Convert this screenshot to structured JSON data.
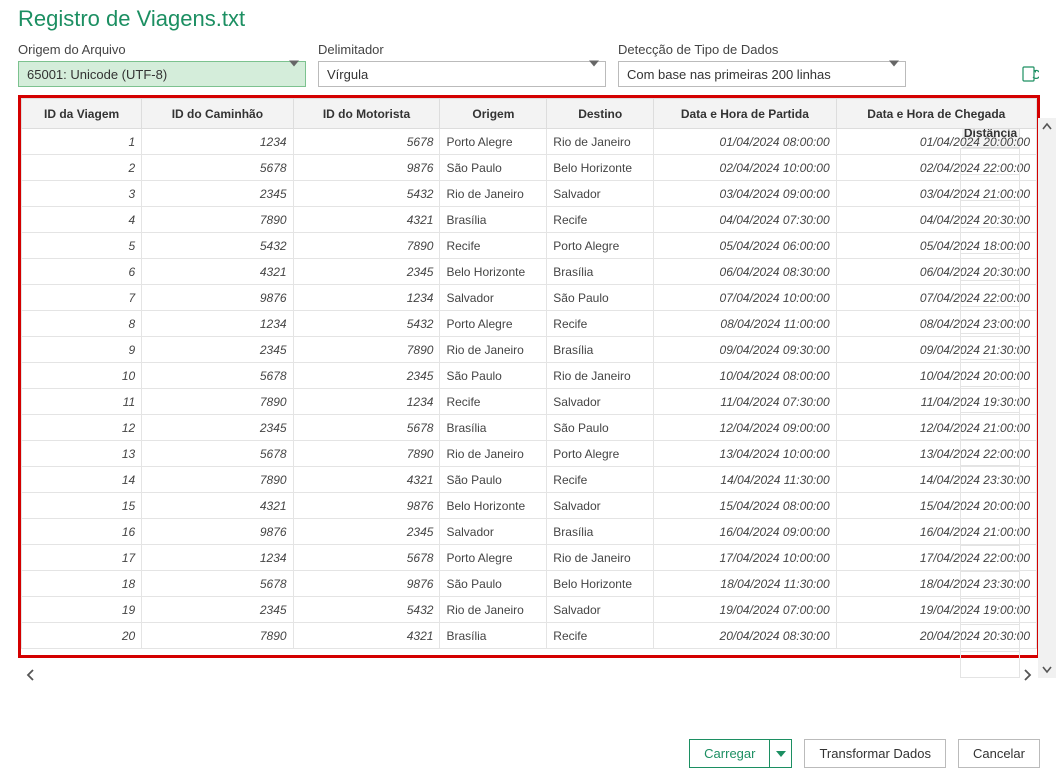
{
  "title": "Registro de Viagens.txt",
  "labels": {
    "origin": "Origem do Arquivo",
    "delimiter": "Delimitador",
    "detection": "Detecção de Tipo de Dados"
  },
  "selects": {
    "origin": "65001: Unicode (UTF-8)",
    "delimiter": "Vírgula",
    "detection": "Com base nas primeiras 200 linhas"
  },
  "columns": {
    "id": "ID da Viagem",
    "truck": "ID do Caminhão",
    "driver": "ID do Motorista",
    "origin": "Origem",
    "dest": "Destino",
    "departure": "Data e Hora de Partida",
    "arrival": "Data e Hora de Chegada",
    "distance": "Distância"
  },
  "rows": [
    {
      "id": "1",
      "truck": "1234",
      "driver": "5678",
      "origin": "Porto Alegre",
      "dest": "Rio de Janeiro",
      "dep": "01/04/2024 08:00:00",
      "arr": "01/04/2024 20:00:00"
    },
    {
      "id": "2",
      "truck": "5678",
      "driver": "9876",
      "origin": "São Paulo",
      "dest": "Belo Horizonte",
      "dep": "02/04/2024 10:00:00",
      "arr": "02/04/2024 22:00:00"
    },
    {
      "id": "3",
      "truck": "2345",
      "driver": "5432",
      "origin": "Rio de Janeiro",
      "dest": "Salvador",
      "dep": "03/04/2024 09:00:00",
      "arr": "03/04/2024 21:00:00"
    },
    {
      "id": "4",
      "truck": "7890",
      "driver": "4321",
      "origin": "Brasília",
      "dest": "Recife",
      "dep": "04/04/2024 07:30:00",
      "arr": "04/04/2024 20:30:00"
    },
    {
      "id": "5",
      "truck": "5432",
      "driver": "7890",
      "origin": "Recife",
      "dest": "Porto Alegre",
      "dep": "05/04/2024 06:00:00",
      "arr": "05/04/2024 18:00:00"
    },
    {
      "id": "6",
      "truck": "4321",
      "driver": "2345",
      "origin": "Belo Horizonte",
      "dest": "Brasília",
      "dep": "06/04/2024 08:30:00",
      "arr": "06/04/2024 20:30:00"
    },
    {
      "id": "7",
      "truck": "9876",
      "driver": "1234",
      "origin": "Salvador",
      "dest": "São Paulo",
      "dep": "07/04/2024 10:00:00",
      "arr": "07/04/2024 22:00:00"
    },
    {
      "id": "8",
      "truck": "1234",
      "driver": "5432",
      "origin": "Porto Alegre",
      "dest": "Recife",
      "dep": "08/04/2024 11:00:00",
      "arr": "08/04/2024 23:00:00"
    },
    {
      "id": "9",
      "truck": "2345",
      "driver": "7890",
      "origin": "Rio de Janeiro",
      "dest": "Brasília",
      "dep": "09/04/2024 09:30:00",
      "arr": "09/04/2024 21:30:00"
    },
    {
      "id": "10",
      "truck": "5678",
      "driver": "2345",
      "origin": "São Paulo",
      "dest": "Rio de Janeiro",
      "dep": "10/04/2024 08:00:00",
      "arr": "10/04/2024 20:00:00"
    },
    {
      "id": "11",
      "truck": "7890",
      "driver": "1234",
      "origin": "Recife",
      "dest": "Salvador",
      "dep": "11/04/2024 07:30:00",
      "arr": "11/04/2024 19:30:00"
    },
    {
      "id": "12",
      "truck": "2345",
      "driver": "5678",
      "origin": "Brasília",
      "dest": "São Paulo",
      "dep": "12/04/2024 09:00:00",
      "arr": "12/04/2024 21:00:00"
    },
    {
      "id": "13",
      "truck": "5678",
      "driver": "7890",
      "origin": "Rio de Janeiro",
      "dest": "Porto Alegre",
      "dep": "13/04/2024 10:00:00",
      "arr": "13/04/2024 22:00:00"
    },
    {
      "id": "14",
      "truck": "7890",
      "driver": "4321",
      "origin": "São Paulo",
      "dest": "Recife",
      "dep": "14/04/2024 11:30:00",
      "arr": "14/04/2024 23:30:00"
    },
    {
      "id": "15",
      "truck": "4321",
      "driver": "9876",
      "origin": "Belo Horizonte",
      "dest": "Salvador",
      "dep": "15/04/2024 08:00:00",
      "arr": "15/04/2024 20:00:00"
    },
    {
      "id": "16",
      "truck": "9876",
      "driver": "2345",
      "origin": "Salvador",
      "dest": "Brasília",
      "dep": "16/04/2024 09:00:00",
      "arr": "16/04/2024 21:00:00"
    },
    {
      "id": "17",
      "truck": "1234",
      "driver": "5678",
      "origin": "Porto Alegre",
      "dest": "Rio de Janeiro",
      "dep": "17/04/2024 10:00:00",
      "arr": "17/04/2024 22:00:00"
    },
    {
      "id": "18",
      "truck": "5678",
      "driver": "9876",
      "origin": "São Paulo",
      "dest": "Belo Horizonte",
      "dep": "18/04/2024 11:30:00",
      "arr": "18/04/2024 23:30:00"
    },
    {
      "id": "19",
      "truck": "2345",
      "driver": "5432",
      "origin": "Rio de Janeiro",
      "dest": "Salvador",
      "dep": "19/04/2024 07:00:00",
      "arr": "19/04/2024 19:00:00"
    },
    {
      "id": "20",
      "truck": "7890",
      "driver": "4321",
      "origin": "Brasília",
      "dest": "Recife",
      "dep": "20/04/2024 08:30:00",
      "arr": "20/04/2024 20:30:00"
    }
  ],
  "buttons": {
    "load": "Carregar",
    "transform": "Transformar Dados",
    "cancel": "Cancelar"
  }
}
